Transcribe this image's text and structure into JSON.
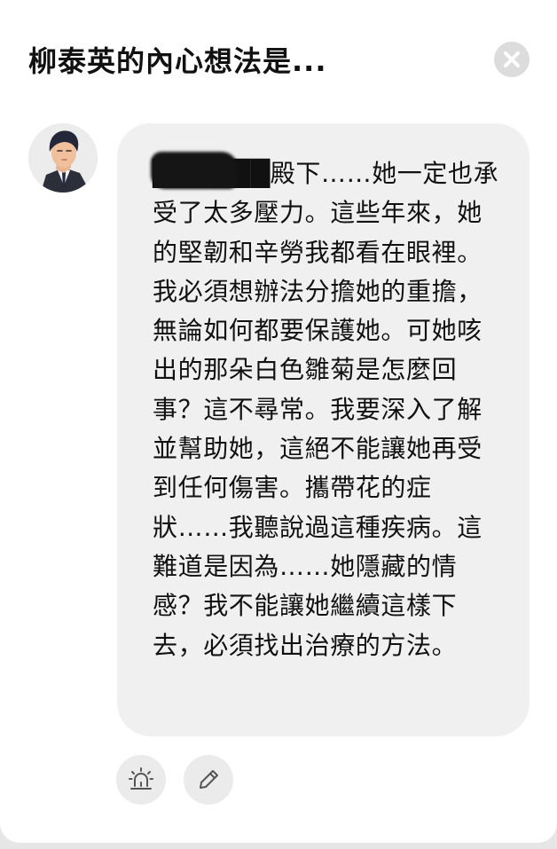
{
  "header": {
    "title": "柳泰英的內心想法是..."
  },
  "close_button": {
    "icon": "close-icon"
  },
  "avatar": {
    "icon": "character-avatar"
  },
  "message": {
    "text": "██████殿下……她一定也承受了太多壓力。這些年來，她的堅韌和辛勞我都看在眼裡。我必須想辦法分擔她的重擔，無論如何都要保護她。可她咳出的那朵白色雛菊是怎麼回事？這不尋常。我要深入了解並幫助她，這絕不能讓她再受到任何傷害。攜帶花的症狀……我聽說過這種疾病。這難道是因為……她隱藏的情感？我不能讓她繼續這樣下去，必須找出治療的方法。"
  },
  "actions": {
    "report_icon": "alarm-siren-icon",
    "edit_icon": "pencil-icon"
  },
  "colors": {
    "sheet": "#ffffff",
    "bubble": "#f0f0f0",
    "button": "#ebebeb",
    "close_button": "#dcdcdc",
    "text": "#111111",
    "icon": "#555555"
  }
}
